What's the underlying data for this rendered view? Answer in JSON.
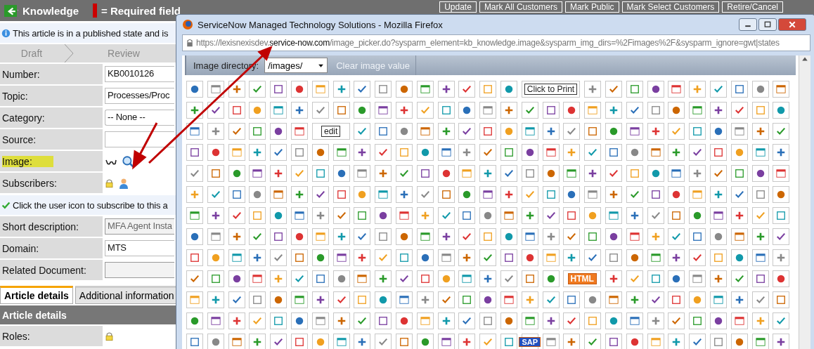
{
  "app_header": {
    "title": "Knowledge",
    "legend": "= Required field"
  },
  "action_buttons": [
    "Update",
    "Mark All Customers",
    "Mark Public",
    "Mark Select Customers",
    "Retire/Cancel"
  ],
  "info_message": "This article is in a published state and is",
  "workflow_steps": [
    {
      "label": "Draft"
    },
    {
      "label": "Review"
    }
  ],
  "fields": [
    {
      "label": "Number:",
      "kind": "text",
      "value": "KB0010126",
      "highlighted": false
    },
    {
      "label": "Topic:",
      "kind": "text",
      "value": "Processes/Proc",
      "highlighted": false
    },
    {
      "label": "Category:",
      "kind": "select",
      "value": "-- None --",
      "highlighted": false
    },
    {
      "label": "Source:",
      "kind": "text",
      "highlighted": false
    },
    {
      "label": "Image:",
      "kind": "image",
      "highlighted": true
    },
    {
      "label": "Subscribers:",
      "kind": "subscribers",
      "highlighted": false
    }
  ],
  "subscribe_message": "Click the user icon to subscribe to this a",
  "more_fields": [
    {
      "label": "Short description:",
      "kind": "readonly",
      "value": "MFA Agent Insta",
      "highlighted": false
    },
    {
      "label": "Domain:",
      "kind": "text",
      "value": "MTS",
      "highlighted": false
    },
    {
      "label": "Related Document:",
      "kind": "readonly",
      "highlighted": false
    }
  ],
  "tabs": [
    {
      "label": "Article details",
      "selected": true
    },
    {
      "label": "Additional information",
      "selected": false
    }
  ],
  "section": {
    "title": "Article details",
    "fields": [
      {
        "label": "Roles:",
        "kind": "locked",
        "highlighted": false
      }
    ]
  },
  "popup": {
    "title": "ServiceNow Managed Technology Solutions - Mozilla Firefox",
    "url_prefix": "https://lexisnexisdev.",
    "url_domain": "service-now.com",
    "url_path": "/image_picker.do?sysparm_element=kb_knowledge.image&sysparm_img_dirs=%2Fimages%2F&sysparm_ignore=gwt|states",
    "directory_label": "Image directory:",
    "directory_value": "/images/",
    "clear_button": "Clear image value",
    "labeled_images": [
      "Click to Print",
      "edit",
      "HTML",
      "SAP"
    ]
  }
}
